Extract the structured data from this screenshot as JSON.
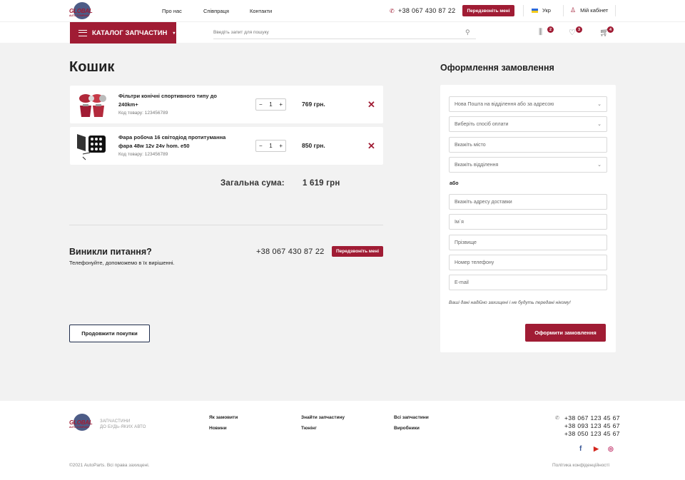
{
  "header": {
    "logo_text": "GLOBAL",
    "logo_subtext": "AUTO COMPANY",
    "nav": [
      "Про нас",
      "Співпраця",
      "Контакти"
    ],
    "phone": "+38  067 430 87 22",
    "callback_label": "Передзвоніть мені",
    "language": "Укр",
    "account_label": "Мій кабінет"
  },
  "searchbar": {
    "catalog_label": "КАТАЛОГ ЗАПЧАСТИН",
    "search_placeholder": "Введіть запит для пошуку",
    "compare_count": "2",
    "wishlist_count": "3",
    "cart_count": "4"
  },
  "cart": {
    "title": "Кошик",
    "items": [
      {
        "name": "Фільтри конічні спортивного типу до 240km+",
        "code": "Код товару: 123456789",
        "qty": "1",
        "price": "769 грн."
      },
      {
        "name": "Фара робоча 16 світодіод протитуманна фара 48w 12v 24v hom. e50",
        "code": "Код товару: 123456789",
        "qty": "1",
        "price": "850 грн."
      }
    ],
    "total_label": "Загальна сума:",
    "total_value": "1 619 грн"
  },
  "questions": {
    "title": "Виникли питання?",
    "subtitle": "Телефонуйте, допоможемо в їх вирішенні.",
    "phone": "+38 067 430 87 22",
    "callback_label": "Передзвоніть мені",
    "continue_label": "Продовжити покупки"
  },
  "order_form": {
    "title": "Оформлення замовлення",
    "delivery_select": "Нова Пошта на відділення або за адресою",
    "payment_select": "Виберіть спосіб оплати",
    "city_placeholder": "Вкажіть місто",
    "branch_select": "Вкажіть відділення",
    "or_label": "або",
    "address_placeholder": "Вкажіть адресу доставки",
    "name_placeholder": "Ім`я",
    "surname_placeholder": "Прізвище",
    "phone_placeholder": "Номер телефону",
    "email_placeholder": "E-mail",
    "privacy_note": "Ваші дані надійно захищені і не будуть передані нікому!",
    "submit_label": "Оформити замовлення"
  },
  "footer": {
    "tagline_1": "ЗАПЧАСТИНИ",
    "tagline_2": "ДО БУДЬ-ЯКИХ АВТО",
    "links": [
      {
        "label": "Як замовити"
      },
      {
        "label": "Новини"
      },
      {
        "label": "Знайти запчастину"
      },
      {
        "label": "Тюнінг"
      },
      {
        "label": "Всі запчастини"
      },
      {
        "label": "Виробники"
      }
    ],
    "phones": [
      "+38  067 123 45 67",
      "+38  093 123 45 67",
      "+38  050 123 45 67"
    ],
    "copyright": "©2021 AutoParts. Всі права захищені.",
    "policy": "Політика конфіденційності"
  },
  "colors": {
    "accent": "#a01c34",
    "dark_blue": "#1f2d4c",
    "background": "#f2f2f2"
  },
  "icons": [
    "phone-icon",
    "user-icon",
    "flag-ua-icon",
    "menu-icon",
    "search-icon",
    "compare-icon",
    "heart-icon",
    "cart-icon",
    "minus-icon",
    "plus-icon",
    "close-icon",
    "facebook-icon",
    "youtube-icon",
    "instagram-icon"
  ]
}
